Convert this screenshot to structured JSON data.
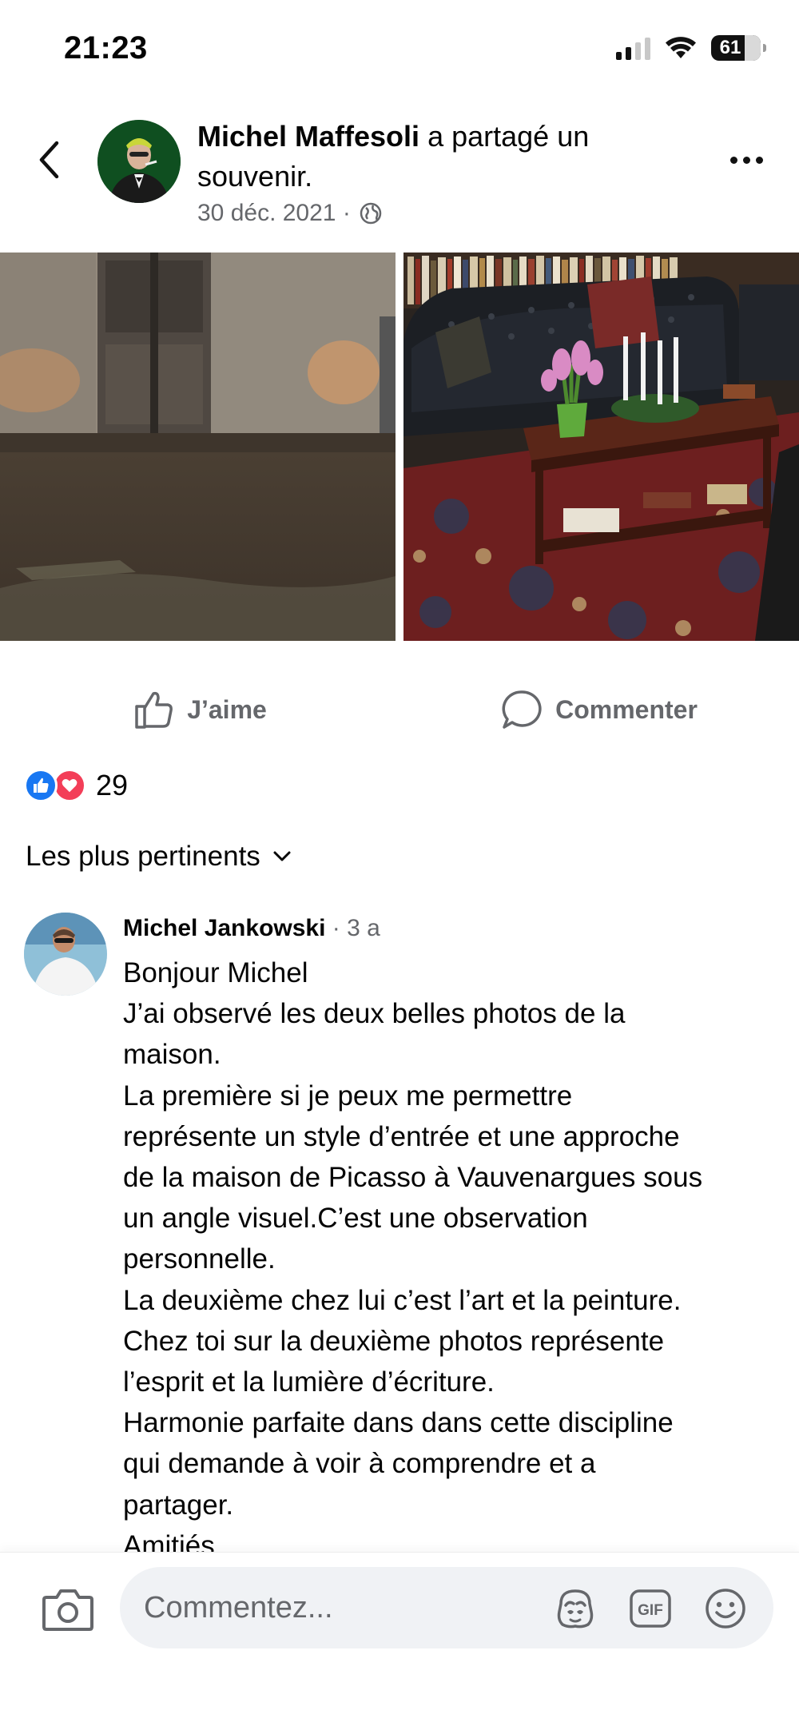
{
  "status_bar": {
    "time": "21:23",
    "battery": "61",
    "icons": [
      "cellular-signal-icon",
      "wifi-icon",
      "battery-icon"
    ]
  },
  "header": {
    "author": "Michel Maffesoli",
    "action_line1": " a partagé un",
    "action_line2": "souvenir.",
    "date": "30 déc. 2021 ·",
    "privacy_icon": "globe-icon",
    "back_icon": "chevron-left-icon",
    "more_icon": "more-horizontal-icon"
  },
  "photos": [
    {
      "subject": "old wooden door at night"
    },
    {
      "subject": "living room with leather sofa and coffee table"
    }
  ],
  "actions": {
    "like_label": "J’aime",
    "comment_label": "Commenter"
  },
  "reactions": {
    "count": "29",
    "types": [
      "like",
      "love"
    ]
  },
  "sort": {
    "label": "Les plus pertinents"
  },
  "comment": {
    "author": "Michel Jankowski",
    "time": " · 3 a",
    "lines": [
      "Bonjour Michel",
      "J’ai observé les deux belles photos de la",
      "maison.",
      "La première si je peux me permettre",
      "représente un style d’entrée et une approche",
      "de la maison de Picasso à Vauvenargues sous",
      "un angle visuel.C’est une observation",
      "personnelle.",
      "La deuxième chez lui c’est l’art et la peinture.",
      "Chez toi sur la deuxième photos représente",
      "l’esprit et la lumière d’écriture.",
      "Harmonie parfaite dans dans cette discipline",
      "qui demande à voir à comprendre et a",
      "partager.",
      "Amitiés"
    ]
  },
  "composer": {
    "placeholder": "Commentez...",
    "gif_label": "GIF",
    "icons": [
      "camera-icon",
      "avatar-sticker-icon",
      "gif-icon",
      "emoji-icon"
    ]
  },
  "colors": {
    "text": "#050505",
    "secondary": "#65676b",
    "like_blue": "#1877f2",
    "love_red": "#f33e58",
    "input_bg": "#f0f2f5"
  }
}
